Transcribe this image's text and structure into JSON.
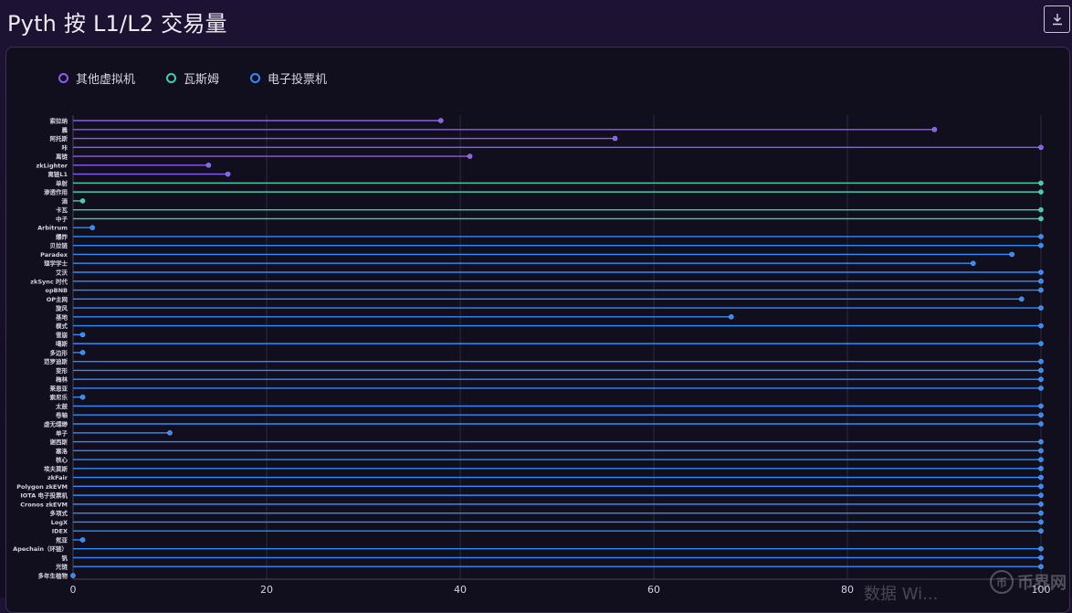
{
  "page": {
    "title": "Pyth 按 L1/L2 交易量"
  },
  "legend": [
    {
      "label": "其他虚拟机",
      "color": "#8b5cf6"
    },
    {
      "label": "瓦斯姆",
      "color": "#3fcfb0"
    },
    {
      "label": "电子投票机",
      "color": "#2f8cff"
    }
  ],
  "watermark": {
    "text": "币界网",
    "icon": "币"
  },
  "watermark2": "数据 Wi...",
  "chart_data": {
    "type": "lollipop",
    "orientation": "horizontal",
    "xlim": [
      0,
      100
    ],
    "xticks": [
      0,
      20,
      40,
      60,
      80,
      100
    ],
    "grid": true,
    "legend_position": "top-left",
    "series": [
      {
        "name": "其他虚拟机",
        "color": "#8b5cf6"
      },
      {
        "name": "瓦斯姆",
        "color": "#3fcfb0"
      },
      {
        "name": "电子投票机",
        "color": "#2f8cff"
      }
    ],
    "rows": [
      {
        "label": "索拉纳",
        "value": 38,
        "series": 0
      },
      {
        "label": "晨",
        "value": 89,
        "series": 0
      },
      {
        "label": "阿托斯",
        "value": 56,
        "series": 0
      },
      {
        "label": "咔",
        "value": 100,
        "series": 0
      },
      {
        "label": "离链",
        "value": 41,
        "series": 0
      },
      {
        "label": "zkLighter",
        "value": 14,
        "series": 0
      },
      {
        "label": "离链L1",
        "value": 16,
        "series": 0
      },
      {
        "label": "单射",
        "value": 100,
        "series": 1
      },
      {
        "label": "渗透作用",
        "value": 100,
        "series": 1
      },
      {
        "label": "酒",
        "value": 1,
        "series": 1
      },
      {
        "label": "卡瓦",
        "value": 100,
        "series": 1
      },
      {
        "label": "中子",
        "value": 100,
        "series": 1
      },
      {
        "label": "Arbitrum",
        "value": 2,
        "series": 2
      },
      {
        "label": "爆炸",
        "value": 100,
        "series": 2
      },
      {
        "label": "贝拉链",
        "value": 100,
        "series": 2
      },
      {
        "label": "Paradex",
        "value": 97,
        "series": 2
      },
      {
        "label": "理学学士",
        "value": 93,
        "series": 2
      },
      {
        "label": "艾沃",
        "value": 100,
        "series": 2
      },
      {
        "label": "zkSync 时代",
        "value": 100,
        "series": 2
      },
      {
        "label": "opBNB",
        "value": 100,
        "series": 2
      },
      {
        "label": "OP主网",
        "value": 98,
        "series": 2
      },
      {
        "label": "旋风",
        "value": 100,
        "series": 2
      },
      {
        "label": "基地",
        "value": 68,
        "series": 2
      },
      {
        "label": "模式",
        "value": 100,
        "series": 2
      },
      {
        "label": "雪崩",
        "value": 1,
        "series": 2
      },
      {
        "label": "噶斯",
        "value": 100,
        "series": 2
      },
      {
        "label": "多边形",
        "value": 1,
        "series": 2
      },
      {
        "label": "范罗迪斯",
        "value": 100,
        "series": 2
      },
      {
        "label": "变形",
        "value": 100,
        "series": 2
      },
      {
        "label": "梅林",
        "value": 100,
        "series": 2
      },
      {
        "label": "莱恩亚",
        "value": 100,
        "series": 2
      },
      {
        "label": "索尼乐",
        "value": 1,
        "series": 2
      },
      {
        "label": "太鼓",
        "value": 100,
        "series": 2
      },
      {
        "label": "卷轴",
        "value": 100,
        "series": 2
      },
      {
        "label": "虚无缥缈",
        "value": 100,
        "series": 2
      },
      {
        "label": "单子",
        "value": 10,
        "series": 2
      },
      {
        "label": "谢西斯",
        "value": 100,
        "series": 2
      },
      {
        "label": "塞洛",
        "value": 100,
        "series": 2
      },
      {
        "label": "核心",
        "value": 100,
        "series": 2
      },
      {
        "label": "埃夫莫斯",
        "value": 100,
        "series": 2
      },
      {
        "label": "zkFair",
        "value": 100,
        "series": 2
      },
      {
        "label": "Polygon zkEVM",
        "value": 100,
        "series": 2
      },
      {
        "label": "IOTA 电子投票机",
        "value": 100,
        "series": 2
      },
      {
        "label": "Cronos zkEVM",
        "value": 100,
        "series": 2
      },
      {
        "label": "多项式",
        "value": 100,
        "series": 2
      },
      {
        "label": "LogX",
        "value": 100,
        "series": 2
      },
      {
        "label": "IDEX",
        "value": 100,
        "series": 2
      },
      {
        "label": "氖亚",
        "value": 1,
        "series": 2
      },
      {
        "label": "Apechain（环链）",
        "value": 100,
        "series": 2
      },
      {
        "label": "钒",
        "value": 100,
        "series": 2
      },
      {
        "label": "光链",
        "value": 100,
        "series": 2
      },
      {
        "label": "多年生植物",
        "value": 0,
        "series": 2
      }
    ]
  }
}
